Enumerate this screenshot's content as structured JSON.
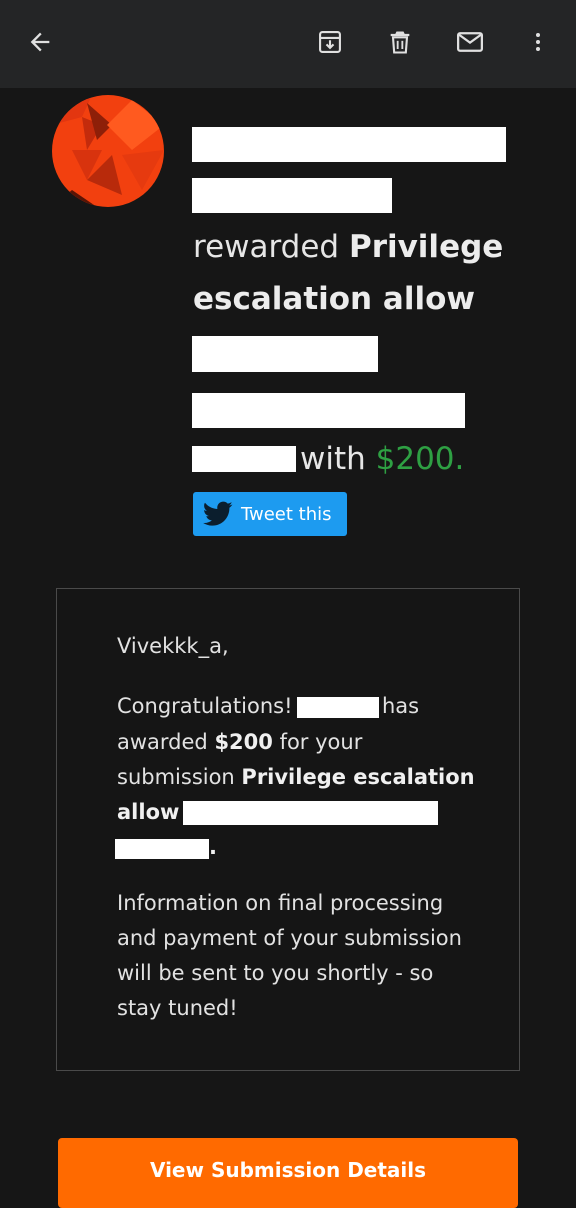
{
  "toolbar": {
    "icons": [
      "back-arrow-icon",
      "archive-icon",
      "trash-icon",
      "mail-icon",
      "more-vert-icon"
    ]
  },
  "headline": {
    "word_rewarded": "rewarded ",
    "title_part1": "Privilege",
    "title_part2": "escalation allow",
    "word_with": " with ",
    "amount": "$200."
  },
  "tweet": {
    "label": "Tweet this"
  },
  "message": {
    "greeting": "Vivekkk_a,",
    "congrats": "Congratulations!",
    "has": "has",
    "awarded": "awarded ",
    "award_amount": "$200",
    "for_your": " for your",
    "submission": "submission ",
    "title_part1": "Privilege escalation",
    "title_part2": "allow",
    "period": ".",
    "info_line1": "Information on final processing",
    "info_line2": "and payment of your submission",
    "info_line3": "will be sent to you shortly - so",
    "info_line4": "stay tuned!"
  },
  "cta": {
    "label": "View Submission Details"
  },
  "colors": {
    "background": "#161616",
    "toolbar": "#242526",
    "amount_green": "#2ea043",
    "twitter_blue": "#1d9bf0",
    "cta_orange": "#ff6a00",
    "avatar_orange": "#f2400f"
  }
}
